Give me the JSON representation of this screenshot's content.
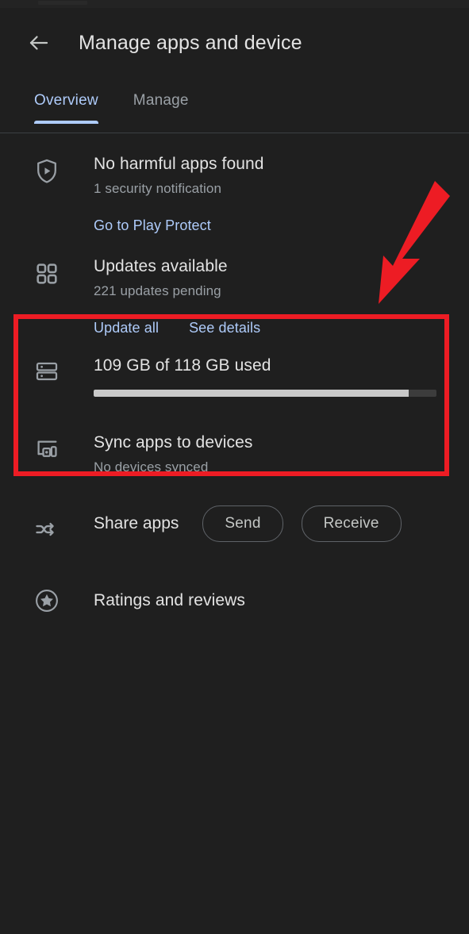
{
  "app": {
    "title": "Manage apps and device",
    "back_icon": "arrow-back-icon"
  },
  "tabs": [
    {
      "label": "Overview",
      "active": true
    },
    {
      "label": "Manage",
      "active": false
    }
  ],
  "rows": {
    "play_protect": {
      "icon": "shield-play-icon",
      "title": "No harmful apps found",
      "subtitle": "1 security notification",
      "action": "Go to Play Protect"
    },
    "updates": {
      "icon": "apps-grid-icon",
      "title": "Updates available",
      "subtitle": "221 updates pending",
      "action_primary": "Update all",
      "action_secondary": "See details"
    },
    "storage": {
      "icon": "storage-icon",
      "title": "109 GB of 118 GB used",
      "used_gb": 109,
      "total_gb": 118,
      "progress_percent": 92
    },
    "sync": {
      "icon": "devices-icon",
      "title": "Sync apps to devices",
      "subtitle": "No devices synced"
    },
    "share": {
      "icon": "share-swap-icon",
      "label": "Share apps",
      "send_label": "Send",
      "receive_label": "Receive"
    },
    "ratings": {
      "icon": "star-circle-icon",
      "title": "Ratings and reviews"
    }
  },
  "annotations": {
    "highlight_color": "#ed1c24",
    "arrow_color": "#ed1c24",
    "box_target": "updates",
    "arrow_target": "updates"
  },
  "colors": {
    "background": "#1f1f1f",
    "accent": "#aecbfa",
    "primary_text": "#e3e3e3",
    "secondary_text": "#9aa0a6",
    "progress_fill": "#c9c9c9",
    "progress_track": "#3c3c3c"
  }
}
